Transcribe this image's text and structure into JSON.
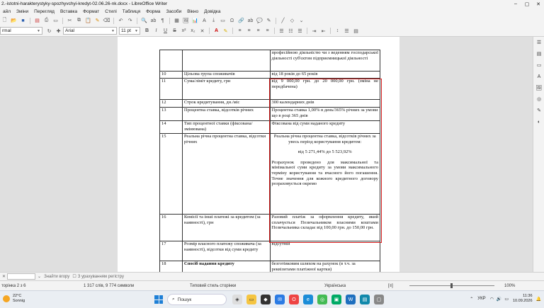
{
  "window": {
    "title": "2.-istotni-harakterystyky-spozhyvchyi-kredyt-02.06.26-nk.docx - LibreOffice Writer"
  },
  "menu": [
    "айл",
    "Зміни",
    "Перегляд",
    "Вставка",
    "Формат",
    "Стилі",
    "Таблиця",
    "Форма",
    "Засоби",
    "Вікно",
    "Довідка"
  ],
  "toolbar": {
    "style_value": "rmal",
    "font_value": "Arial",
    "size_value": "11 pt"
  },
  "table": {
    "rows": [
      {
        "n": "",
        "label": "",
        "value": "професійною діяльністю чи з веденням господарської діяльності суб'єктом підприємницької діяльності"
      },
      {
        "n": "10",
        "label": "Цільова група споживачів",
        "value": "від 18 років до 65 років"
      },
      {
        "n": "11",
        "label": "Сума/ліміт кредиту, грн",
        "value": "від 9 000,00 грн. до 20 000,00 грн. (зміна не передбачена)"
      },
      {
        "n": "12",
        "label": "Строк кредитування, дн./міс",
        "value": "300 календарних днів"
      },
      {
        "n": "13",
        "label": "Процентна ставка, відсотків річних",
        "value": "Процентна ставка 1,00% в день/365% річних за умови що в році 365 днів"
      },
      {
        "n": "14",
        "label": "Тип процентної ставки (фіксована/змінювана)",
        "value": "Фіксована від суми наданого кредиту"
      },
      {
        "n": "15",
        "label": "Реальна річна процентна ставка, відсотки річних",
        "value_head": "Реальна річна процентна ставка, відсотків річних за увесь період користування кредитом:",
        "value_range": "від 5 271,44% до 5 523,92%",
        "value_tail": "Розрахунок проведено для максимальної та мінімальної суми кредиту за умови максимального терміну користування та вчасного його погашення. Точне значення для кожного кредитного договору розраховується окремо"
      },
      {
        "n": "16",
        "label": "Комісії та інші платежі за кредитом (за наявності), грн",
        "value": "Разовий платіж за оформлення кредиту, який сплачується Позичальником власними коштами Позичальника складає від 100,00 грн. до 150,00 грн."
      },
      {
        "n": "17",
        "label": "Розмір власного платежу споживача (за наявності), відсотки від суми кредиту",
        "value": "відсутній"
      },
      {
        "n": "18",
        "label": "Спосіб надання кредиту",
        "value": "безготівковим шляхом на рахунок (в т.ч. за реквізитами платіжної картки)"
      }
    ]
  },
  "findbar": {
    "prev": "Знайти вгору",
    "match_case": "З урахуванням регістру"
  },
  "status": {
    "page": "торінка 2 з 6",
    "words": "1 317 слів, 9 774 символи",
    "page_style": "Типовий стиль сторінки",
    "language": "Українська",
    "zoom": "100%"
  },
  "taskbar": {
    "temp": "22°C",
    "weather": "Sonnig",
    "search": "Пошук",
    "lang": "УКР",
    "time": "11:36",
    "date": "10.09.2026"
  },
  "colors": {
    "highlight_box": "#d41b1b"
  }
}
